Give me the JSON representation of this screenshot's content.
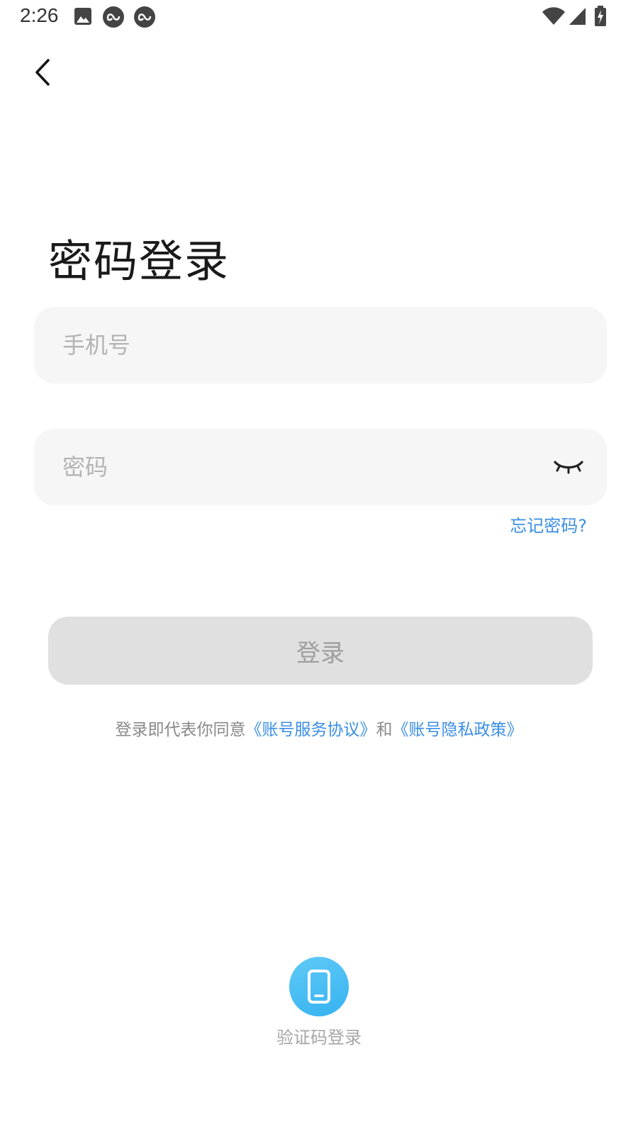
{
  "status_bar": {
    "time": "2:26",
    "icons": [
      "image-icon",
      "infinity-icon",
      "infinity-icon",
      "wifi-icon",
      "signal-icon",
      "battery-charging-icon"
    ]
  },
  "header": {
    "back_icon": "chevron-left-icon"
  },
  "page": {
    "title": "密码登录"
  },
  "form": {
    "phone_placeholder": "手机号",
    "phone_value": "",
    "password_placeholder": "密码",
    "password_value": "",
    "eye_icon": "eye-closed-icon",
    "forgot_password": "忘记密码?",
    "login_button": "登录"
  },
  "agreement": {
    "prefix": "登录即代表你同意",
    "service_link": "《账号服务协议》",
    "conjunction": "和",
    "privacy_link": "《账号隐私政策》"
  },
  "alt_login": {
    "icon": "phone-icon",
    "label": "验证码登录"
  },
  "colors": {
    "accent": "#3a8ee6",
    "input_bg": "#f6f6f6",
    "button_disabled_bg": "#e0e0e0",
    "sms_icon_bg": "#45bdf4"
  }
}
